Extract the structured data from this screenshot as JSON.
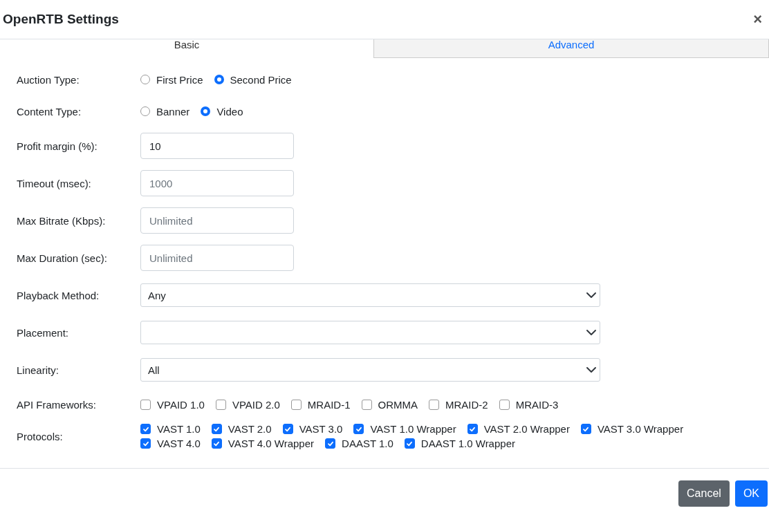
{
  "dialog": {
    "title": "OpenRTB Settings",
    "close": "×"
  },
  "tabs": [
    {
      "label": "Basic",
      "selected": true
    },
    {
      "label": "Advanced",
      "selected": false
    }
  ],
  "fields": [
    {
      "kind": "radio",
      "label": "Auction Type:",
      "options": [
        {
          "label": "First Price",
          "selected": false
        },
        {
          "label": "Second Price",
          "selected": true
        }
      ]
    },
    {
      "kind": "radio",
      "label": "Content Type:",
      "options": [
        {
          "label": "Banner",
          "selected": false
        },
        {
          "label": "Video",
          "selected": true
        }
      ]
    },
    {
      "kind": "input",
      "label": "Profit margin (%):",
      "value": "10"
    },
    {
      "kind": "input",
      "label": "Timeout (msec):",
      "placeholder": "1000"
    },
    {
      "kind": "input",
      "label": "Max Bitrate (Kbps):",
      "placeholder": "Unlimited"
    },
    {
      "kind": "input",
      "label": "Max Duration (sec):",
      "placeholder": "Unlimited"
    },
    {
      "kind": "select",
      "label": "Playback Method:",
      "value": "Any"
    },
    {
      "kind": "select",
      "label": "Placement:"
    },
    {
      "kind": "select",
      "label": "Linearity:",
      "value": "All"
    },
    {
      "kind": "checkbox",
      "label": "API Frameworks:",
      "options": [
        {
          "label": "VPAID 1.0",
          "checked": false
        },
        {
          "label": "VPAID 2.0",
          "checked": false
        },
        {
          "label": "MRAID-1",
          "checked": false
        },
        {
          "label": "ORMMA",
          "checked": false
        },
        {
          "label": "MRAID-2",
          "checked": false
        },
        {
          "label": "MRAID-3",
          "checked": false
        }
      ]
    },
    {
      "kind": "checkbox",
      "label": "Protocols:",
      "options": [
        {
          "label": "VAST 1.0",
          "checked": true
        },
        {
          "label": "VAST 2.0",
          "checked": true
        },
        {
          "label": "VAST 3.0",
          "checked": true
        },
        {
          "label": "VAST 1.0 Wrapper",
          "checked": true
        },
        {
          "label": "VAST 2.0 Wrapper",
          "checked": true
        },
        {
          "label": "VAST 3.0 Wrapper",
          "checked": true
        },
        {
          "label": "VAST 4.0",
          "checked": true
        },
        {
          "label": "VAST 4.0 Wrapper",
          "checked": true
        },
        {
          "label": "DAAST 1.0",
          "checked": true
        },
        {
          "label": "DAAST 1.0 Wrapper",
          "checked": true
        }
      ]
    }
  ],
  "buttons": [
    {
      "kind": "secondary",
      "label": "Cancel"
    },
    {
      "kind": "primary",
      "label": "OK"
    }
  ]
}
